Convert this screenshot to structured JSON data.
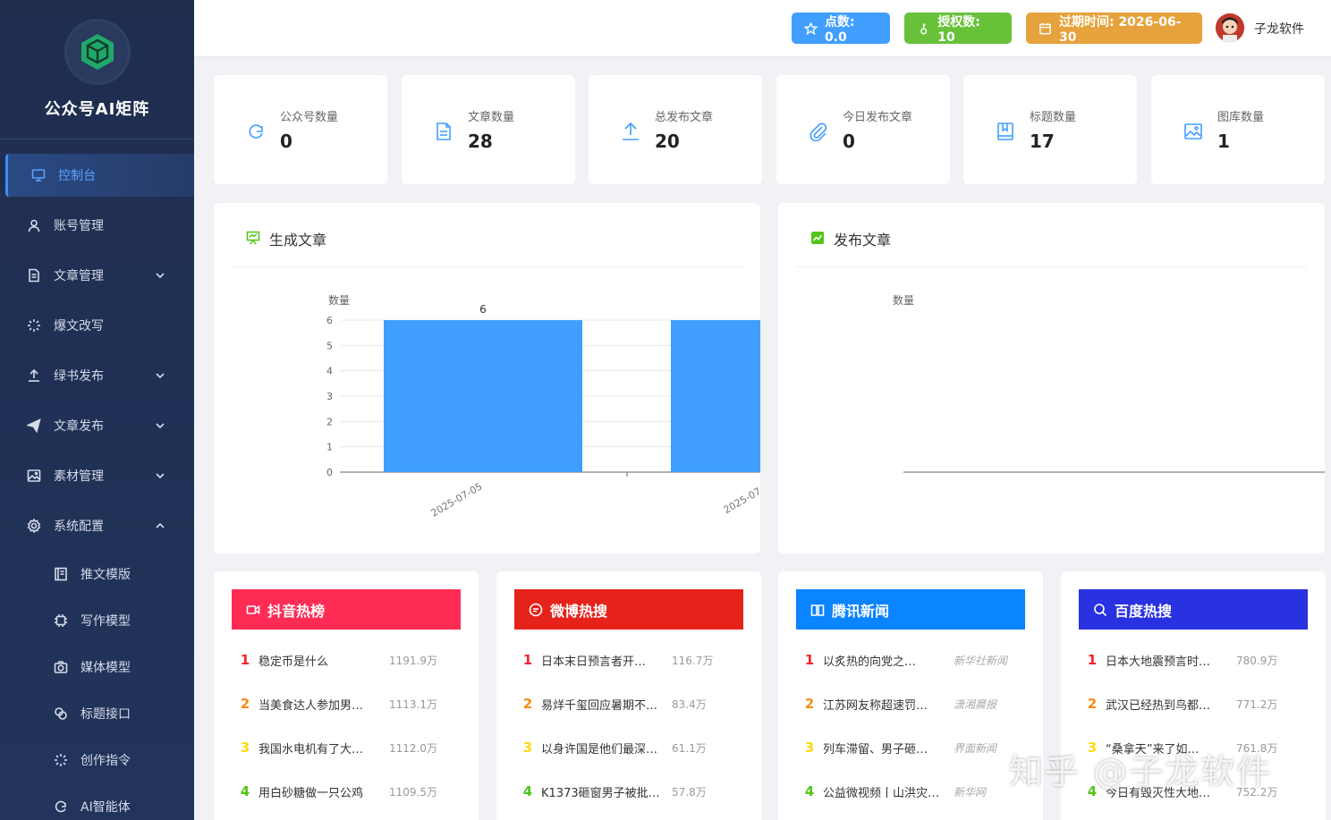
{
  "brand": {
    "title": "公众号AI矩阵"
  },
  "sidebar": {
    "items": [
      {
        "label": "控制台",
        "icon": "monitor-icon",
        "active": true
      },
      {
        "label": "账号管理",
        "icon": "user-icon"
      },
      {
        "label": "文章管理",
        "icon": "document-icon",
        "expand": "down"
      },
      {
        "label": "爆文改写",
        "icon": "loading-icon"
      },
      {
        "label": "绿书发布",
        "icon": "upload-icon",
        "expand": "down"
      },
      {
        "label": "文章发布",
        "icon": "send-icon",
        "expand": "down"
      },
      {
        "label": "素材管理",
        "icon": "picture-icon",
        "expand": "down"
      },
      {
        "label": "系统配置",
        "icon": "gear-icon",
        "expand": "up"
      }
    ],
    "subitems": [
      {
        "label": "推文模版",
        "icon": "template-icon"
      },
      {
        "label": "写作模型",
        "icon": "cpu-icon"
      },
      {
        "label": "媒体模型",
        "icon": "camera-icon"
      },
      {
        "label": "标题接口",
        "icon": "link-icon"
      },
      {
        "label": "创作指令",
        "icon": "sparkle-icon"
      },
      {
        "label": "AI智能体",
        "icon": "agent-icon"
      }
    ]
  },
  "header": {
    "points": "点数: 0.0",
    "auth": "授权数: 10",
    "expire": "过期时间: 2026-06-30",
    "username": "子龙软件"
  },
  "stats": [
    {
      "label": "公众号数量",
      "value": "0",
      "icon": "refresh-icon"
    },
    {
      "label": "文章数量",
      "value": "28",
      "icon": "document-icon"
    },
    {
      "label": "总发布文章",
      "value": "20",
      "icon": "upload-icon"
    },
    {
      "label": "今日发布文章",
      "value": "0",
      "icon": "paperclip-icon"
    },
    {
      "label": "标题数量",
      "value": "17",
      "icon": "notebook-icon"
    },
    {
      "label": "图库数量",
      "value": "1",
      "icon": "picture-icon"
    }
  ],
  "charts": {
    "generated_title": "生成文章",
    "published_title": "发布文章"
  },
  "chart_data": [
    {
      "type": "bar",
      "title": "生成文章",
      "ylabel": "数量",
      "xlabel": "",
      "categories": [
        "2025-07-05",
        "2025-07-0"
      ],
      "values": [
        6,
        6
      ],
      "data_labels": [
        "6"
      ],
      "ylim": [
        0,
        6
      ],
      "yticks": [
        "0",
        "1",
        "2",
        "3",
        "4",
        "5",
        "6"
      ],
      "grid": true,
      "color": "#409eff"
    },
    {
      "type": "bar",
      "title": "发布文章",
      "ylabel": "数量",
      "xlabel": "",
      "categories": [],
      "values": []
    }
  ],
  "hot_lists": [
    {
      "title": "抖音热榜",
      "color": "#fe2c55",
      "icon": "video-icon",
      "items": [
        {
          "title": "稳定币是什么",
          "value": "1191.9万"
        },
        {
          "title": "当美食达人参加男…",
          "value": "1113.1万"
        },
        {
          "title": "我国水电机有了大…",
          "value": "1112.0万"
        },
        {
          "title": "用白砂糖做一只公鸡",
          "value": "1109.5万"
        }
      ]
    },
    {
      "title": "微博热搜",
      "color": "#e6231b",
      "icon": "chat-icon",
      "items": [
        {
          "title": "日本末日预言者开…",
          "value": "116.7万"
        },
        {
          "title": "易烊千玺回应暑期不…",
          "value": "83.4万"
        },
        {
          "title": "以身许国是他们最深…",
          "value": "61.1万"
        },
        {
          "title": "K1373砸窗男子被批…",
          "value": "57.8万"
        }
      ]
    },
    {
      "title": "腾讯新闻",
      "color": "#0a84ff",
      "icon": "book-icon",
      "items": [
        {
          "title": "以炙热的向党之…",
          "value": "新华社新闻"
        },
        {
          "title": "江苏网友称超速罚…",
          "value": "潇湘晨报"
        },
        {
          "title": "列车滞留、男子砸…",
          "value": "界面新闻"
        },
        {
          "title": "公益微视频丨山洪灾…",
          "value": "新华网"
        }
      ]
    },
    {
      "title": "百度热搜",
      "color": "#2932e1",
      "icon": "search-icon",
      "items": [
        {
          "title": "日本大地震预言时…",
          "value": "780.9万"
        },
        {
          "title": "武汉已经热到鸟都…",
          "value": "771.2万"
        },
        {
          "title": "“桑拿天”来了如…",
          "value": "761.8万"
        },
        {
          "title": "今日有毁灭性大地…",
          "value": "752.2万"
        }
      ]
    }
  ],
  "rank_colors": [
    "#f5222d",
    "#fa8c16",
    "#fadb14",
    "#52c41a"
  ],
  "watermark": "知乎 @子龙软件"
}
